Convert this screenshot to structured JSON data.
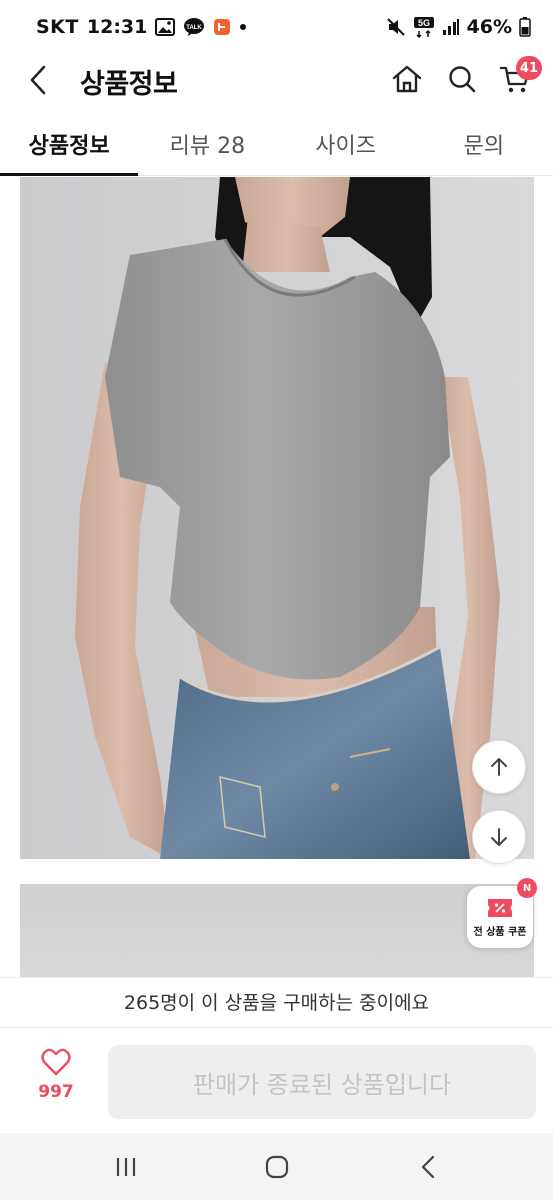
{
  "status_bar": {
    "carrier": "SKT",
    "time": "12:31",
    "network": "5G",
    "battery": "46%"
  },
  "header": {
    "title": "상품정보",
    "cart_count": "41",
    "icons": [
      "back-icon",
      "home-icon",
      "search-icon",
      "cart-icon"
    ]
  },
  "tabs": [
    {
      "label": "상품정보",
      "active": true
    },
    {
      "label": "리뷰 28",
      "active": false
    },
    {
      "label": "사이즈",
      "active": false
    },
    {
      "label": "문의",
      "active": false
    }
  ],
  "coupon": {
    "label": "전 상품 쿠폰",
    "badge": "N"
  },
  "purchase_notice": "265명이 이 상품을 구매하는 중이에요",
  "bottom": {
    "wish_count": "997",
    "buy_label": "판매가 종료된 상품입니다"
  },
  "colors": {
    "accent": "#ef4a5f",
    "disabled_bg": "#eeeeef",
    "disabled_text": "#c4c4c6"
  }
}
